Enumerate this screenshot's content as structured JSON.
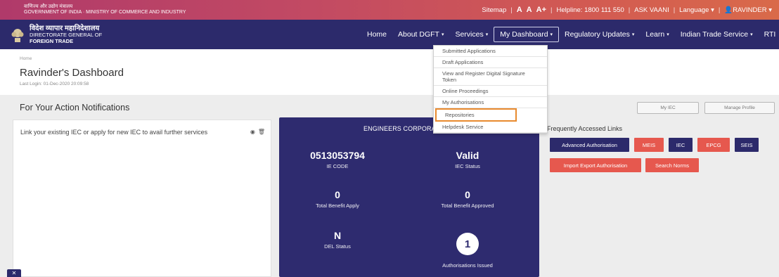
{
  "topbar": {
    "gov_line1": "वाणिज्य और उद्योग मंत्रालय",
    "gov_line2": "GOVERNMENT OF INDIA · MINISTRY OF COMMERCE AND INDUSTRY",
    "sitemap": "Sitemap",
    "font_small": "A",
    "font_normal": "A",
    "font_large": "A+",
    "helpline": "Helpline: 1800 111 550",
    "ask_vaani": "ASK VAANI",
    "language": "Language",
    "user": "RAVINDER"
  },
  "brand": {
    "hindi": "विदेश व्यापार महानिदेशालय",
    "line1": "DIRECTORATE GENERAL OF",
    "line2": "FOREIGN TRADE"
  },
  "nav": {
    "items": [
      {
        "label": "Home",
        "caret": ""
      },
      {
        "label": "About DGFT",
        "caret": "▾"
      },
      {
        "label": "Services",
        "caret": "▾"
      },
      {
        "label": "My Dashboard",
        "caret": "▾"
      },
      {
        "label": "Regulatory Updates",
        "caret": "▾"
      },
      {
        "label": "Learn",
        "caret": "▾"
      },
      {
        "label": "Indian Trade Service",
        "caret": "▾"
      },
      {
        "label": "RTI",
        "caret": ""
      }
    ]
  },
  "dropdown": {
    "items": [
      "Submitted Applications",
      "Draft Applications",
      "View and Register Digital Signature Token",
      "Online Proceedings",
      "My Authorisations",
      "Repositories",
      "Helpdesk Service"
    ]
  },
  "page": {
    "breadcrumb": "Home",
    "title": "Ravinder's Dashboard",
    "last_login": "Last Login: 01-Dec-2020 20:09:58"
  },
  "notifications": {
    "title": "For Your Action Notifications",
    "message": "Link your existing IEC or apply for new IEC to avail further services",
    "view_icon": "◉",
    "delete_icon": "🗑"
  },
  "card": {
    "company": "ENGINEERS CORPORATION",
    "iec_code": "0513053794",
    "iec_code_label": "IE CODE",
    "iec_status": "Valid",
    "iec_status_label": "IEC Status",
    "benefit_apply": "0",
    "benefit_apply_label": "Total Benefit Apply",
    "benefit_approved": "0",
    "benefit_approved_label": "Total Benefit Approved",
    "del_status": "N",
    "del_status_label": "DEL Status",
    "auth_issued": "1",
    "auth_issued_label": "Authorisations Issued"
  },
  "side": {
    "my_iec": "My IEC",
    "manage_profile": "Manage Profile",
    "fal_title": "Frequently Accessed Links",
    "links_row1": [
      "Advanced Authorisation",
      "MEIS",
      "IEC",
      "EPCG",
      "SEIS"
    ],
    "links_row2": [
      "Import Export Authorisation",
      "Search Norms"
    ]
  },
  "colors": {
    "navy": "#2c2a6b",
    "red": "#e6584e",
    "highlight": "#e88a2e"
  }
}
